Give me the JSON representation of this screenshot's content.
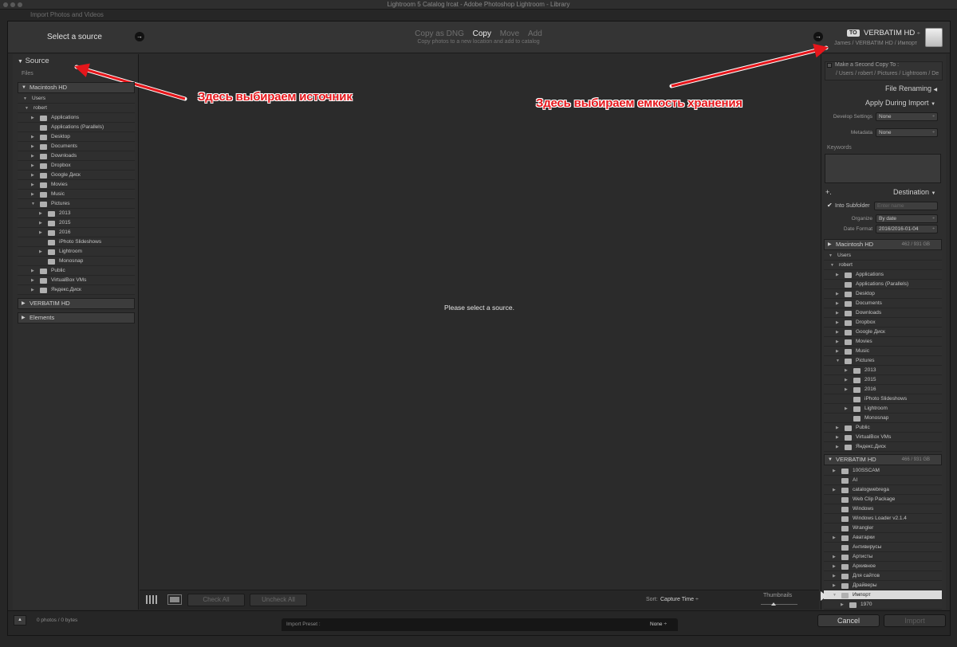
{
  "window": {
    "title": "Lightroom 5 Catalog lrcat - Adobe Photoshop Lightroom - Library",
    "bg_window_label": "Import Photos and Videos"
  },
  "header": {
    "select_source": "Select a source",
    "modes": [
      "Copy as DNG",
      "Copy",
      "Move",
      "Add"
    ],
    "active_mode": "Copy",
    "mode_subtitle": "Copy photos to a new location and add to catalog",
    "to_badge": "TO",
    "to_name": "VERBATIM HD",
    "to_path": "James / VERBATIM HD / Импорт"
  },
  "source": {
    "title": "Source",
    "files_label": "Files",
    "volumes": [
      {
        "name": "Macintosh HD"
      },
      {
        "name": "VERBATIM HD"
      },
      {
        "name": "Elements"
      }
    ],
    "users": "Users",
    "user": "robert",
    "folders": [
      "Applications",
      "Applications (Parallels)",
      "Desktop",
      "Documents",
      "Downloads",
      "Dropbox",
      "Google Диск",
      "Movies",
      "Music",
      "Pictures"
    ],
    "pictures_sub": [
      "2013",
      "2015",
      "2016",
      "iPhoto Slideshows",
      "Lightroom",
      "Monosnap"
    ],
    "after_folders": [
      "Public",
      "VirtualBox VMs",
      "Яндекс.Диск"
    ]
  },
  "center": {
    "empty_message": "Please select a source.",
    "check_all": "Check All",
    "uncheck_all": "Uncheck All",
    "sort_label": "Sort:",
    "sort_value": "Capture Time",
    "thumbnails_label": "Thumbnails",
    "thumbnail_size": 0.35
  },
  "right": {
    "second_copy_label": "Make a Second Copy To :",
    "second_copy_path": "/ Users / robert / Pictures / Lightroom / De",
    "file_renaming": "File Renaming",
    "apply_during_import": "Apply During Import",
    "develop_settings_label": "Develop Settings",
    "develop_settings_value": "None",
    "metadata_label": "Metadata",
    "metadata_value": "None",
    "keywords_label": "Keywords",
    "destination": "Destination",
    "plus": "+.",
    "into_subfolder": "Into Subfolder",
    "subfolder_placeholder": "Enter name",
    "organize_label": "Organize",
    "organize_value": "By date",
    "date_format_label": "Date Format",
    "date_format_value": "2016/2016-01-04",
    "mac_hd": "Macintosh HD",
    "mac_hd_cap": "462 / 931 GB",
    "verbatim": "VERBATIM HD",
    "verbatim_cap": "466 / 931 GB",
    "users": "Users",
    "user": "robert",
    "folders": [
      "Applications",
      "Applications (Parallels)",
      "Desktop",
      "Documents",
      "Downloads",
      "Dropbox",
      "Google Диск",
      "Movies",
      "Music",
      "Pictures"
    ],
    "pictures_sub": [
      "2013",
      "2015",
      "2016",
      "iPhoto Slideshows",
      "Lightroom",
      "Monosnap"
    ],
    "after_folders": [
      "Public",
      "VirtualBox VMs",
      "Яндекс.Диск"
    ],
    "verbatim_folders": [
      "100SSCAM",
      "AI",
      "catalogwebrega",
      "Web Clip Package",
      "Windows",
      "Windows Loader v2.1.4",
      "Wrangler",
      "Аватарки",
      "Антивирусы",
      "Артисты",
      "Архивное",
      "Для сайтов",
      "Драйверы",
      "Импорт"
    ],
    "selected_folder": "Импорт",
    "import_sub": "1970"
  },
  "footer": {
    "count": "0 photos / 0 bytes",
    "import_preset_label": "Import Preset :",
    "import_preset_value": "None",
    "cancel": "Cancel",
    "import": "Import"
  },
  "annotations": {
    "left": "Здесь выбираем источник",
    "right": "Здесь выбираем емкость хранения",
    "color": "#e5161b"
  }
}
